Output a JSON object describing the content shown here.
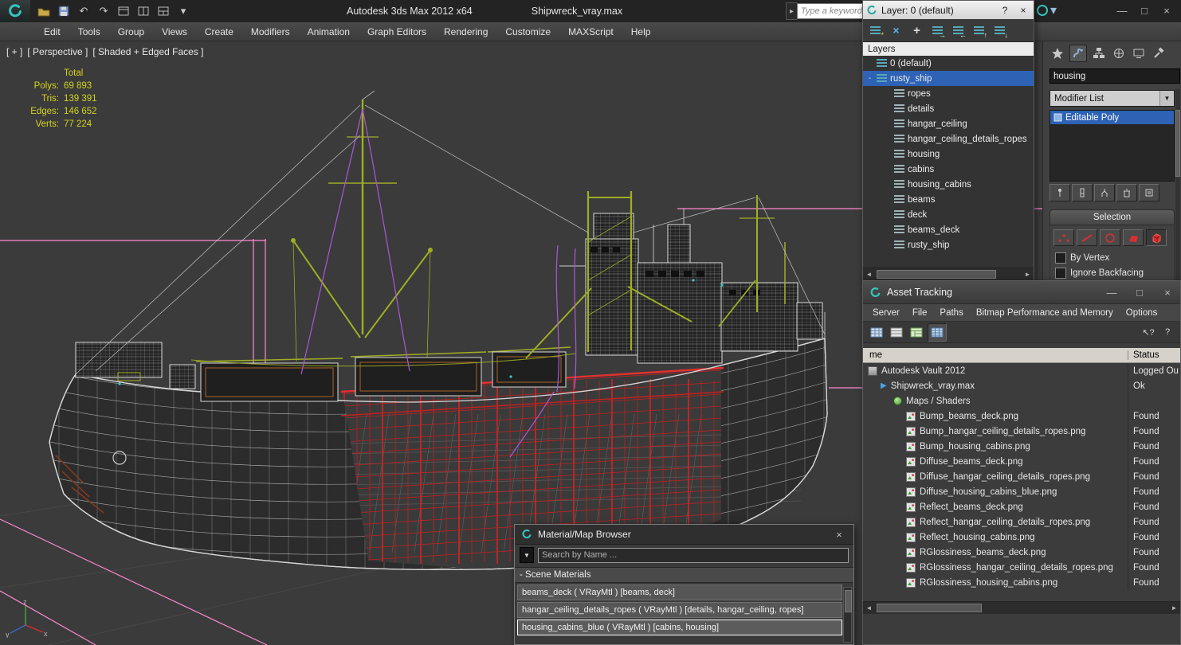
{
  "window": {
    "app_title": "Autodesk 3ds Max 2012 x64",
    "file_title": "Shipwreck_vray.max"
  },
  "search_keyword": {
    "placeholder": "Type a keyword"
  },
  "menubar": {
    "items": [
      "Edit",
      "Tools",
      "Group",
      "Views",
      "Create",
      "Modifiers",
      "Animation",
      "Graph Editors",
      "Rendering",
      "Customize",
      "MAXScript",
      "Help"
    ]
  },
  "viewport": {
    "label_parts": [
      "[ + ]",
      "[ Perspective ]",
      "[ Shaded + Edged Faces ]"
    ],
    "stats": {
      "header": "Total",
      "rows": [
        {
          "label": "Polys:",
          "value": "69 893"
        },
        {
          "label": "Tris:",
          "value": "139 391"
        },
        {
          "label": "Edges:",
          "value": "146 652"
        },
        {
          "label": "Verts:",
          "value": "77 224"
        }
      ]
    },
    "axis_labels": {
      "x": "x",
      "y": "y",
      "z": "z"
    }
  },
  "layer_panel": {
    "title": "Layer: 0 (default)",
    "layers_header": "Layers",
    "items": [
      {
        "label": "0 (default)",
        "indent": 0,
        "selected": false,
        "expander": ""
      },
      {
        "label": "rusty_ship",
        "indent": 0,
        "selected": true,
        "expander": "-"
      },
      {
        "label": "ropes",
        "indent": 1
      },
      {
        "label": "details",
        "indent": 1
      },
      {
        "label": "hangar_ceiling",
        "indent": 1
      },
      {
        "label": "hangar_ceiling_details_ropes",
        "indent": 1
      },
      {
        "label": "housing",
        "indent": 1
      },
      {
        "label": "cabins",
        "indent": 1
      },
      {
        "label": "housing_cabins",
        "indent": 1
      },
      {
        "label": "beams",
        "indent": 1
      },
      {
        "label": "deck",
        "indent": 1
      },
      {
        "label": "beams_deck",
        "indent": 1
      },
      {
        "label": "rusty_ship",
        "indent": 1
      }
    ]
  },
  "command_panel": {
    "object_name": "housing",
    "modifier_list_label": "Modifier List",
    "stack": [
      {
        "label": "Editable Poly",
        "selected": true
      }
    ],
    "selection": {
      "title": "Selection",
      "by_vertex_label": "By Vertex",
      "ignore_backfacing_label": "Ignore Backfacing"
    }
  },
  "asset_tracking": {
    "title": "Asset Tracking",
    "menu_items": [
      "Server",
      "File",
      "Paths",
      "Bitmap Performance and Memory",
      "Options"
    ],
    "columns": {
      "name": "me",
      "status": "Status"
    },
    "rows": [
      {
        "icon": "vault",
        "indent": 0,
        "name": "Autodesk Vault 2012",
        "status": "Logged Ou"
      },
      {
        "icon": "max",
        "indent": 1,
        "name": "Shipwreck_vray.max",
        "status": "Ok"
      },
      {
        "icon": "maps",
        "indent": 2,
        "name": "Maps / Shaders",
        "status": ""
      },
      {
        "icon": "png",
        "indent": 3,
        "name": "Bump_beams_deck.png",
        "status": "Found"
      },
      {
        "icon": "png",
        "indent": 3,
        "name": "Bump_hangar_ceiling_details_ropes.png",
        "status": "Found"
      },
      {
        "icon": "png",
        "indent": 3,
        "name": "Bump_housing_cabins.png",
        "status": "Found"
      },
      {
        "icon": "png",
        "indent": 3,
        "name": "Diffuse_beams_deck.png",
        "status": "Found"
      },
      {
        "icon": "png",
        "indent": 3,
        "name": "Diffuse_hangar_ceiling_details_ropes.png",
        "status": "Found"
      },
      {
        "icon": "png",
        "indent": 3,
        "name": "Diffuse_housing_cabins_blue.png",
        "status": "Found"
      },
      {
        "icon": "png",
        "indent": 3,
        "name": "Reflect_beams_deck.png",
        "status": "Found"
      },
      {
        "icon": "png",
        "indent": 3,
        "name": "Reflect_hangar_ceiling_details_ropes.png",
        "status": "Found"
      },
      {
        "icon": "png",
        "indent": 3,
        "name": "Reflect_housing_cabins.png",
        "status": "Found"
      },
      {
        "icon": "png",
        "indent": 3,
        "name": "RGlossiness_beams_deck.png",
        "status": "Found"
      },
      {
        "icon": "png",
        "indent": 3,
        "name": "RGlossiness_hangar_ceiling_details_ropes.png",
        "status": "Found"
      },
      {
        "icon": "png",
        "indent": 3,
        "name": "RGlossiness_housing_cabins.png",
        "status": "Found"
      }
    ]
  },
  "material_browser": {
    "title": "Material/Map Browser",
    "search_placeholder": "Search by Name ...",
    "group_header": "- Scene Materials",
    "items": [
      {
        "label": "beams_deck ( VRayMtl ) [beams, deck]",
        "selected": false
      },
      {
        "label": "hangar_ceiling_details_ropes ( VRayMtl ) [details, hangar_ceiling, ropes]",
        "selected": false
      },
      {
        "label": "housing_cabins_blue ( VRayMtl ) [cabins, housing]",
        "selected": true
      }
    ]
  },
  "icons": {
    "close": "×",
    "minimize": "—",
    "maximize": "□",
    "help": "?",
    "dropdown": "▼",
    "caret_down": "▾",
    "scroll_left": "◄",
    "scroll_right": "►",
    "chevron": "▸",
    "undo": "↶",
    "redo": "↷",
    "add": "+",
    "delete_x": "×",
    "star": "*",
    "arrow_right": "→",
    "arrow_left": "←",
    "arrow_up": "↑",
    "arrow_down": "↓",
    "context_help": "↖?",
    "play": "▶"
  },
  "colors": {
    "selection_blue": "#2d62b5",
    "helper_pink": "#ff8ad0",
    "wire_white": "#d8d8d8",
    "wire_red": "#c42020",
    "wire_green": "#9fae24",
    "wire_purple": "#a958d8",
    "object_color_swatch": "#2bd32b",
    "stats_yellow": "#d3d31e"
  }
}
